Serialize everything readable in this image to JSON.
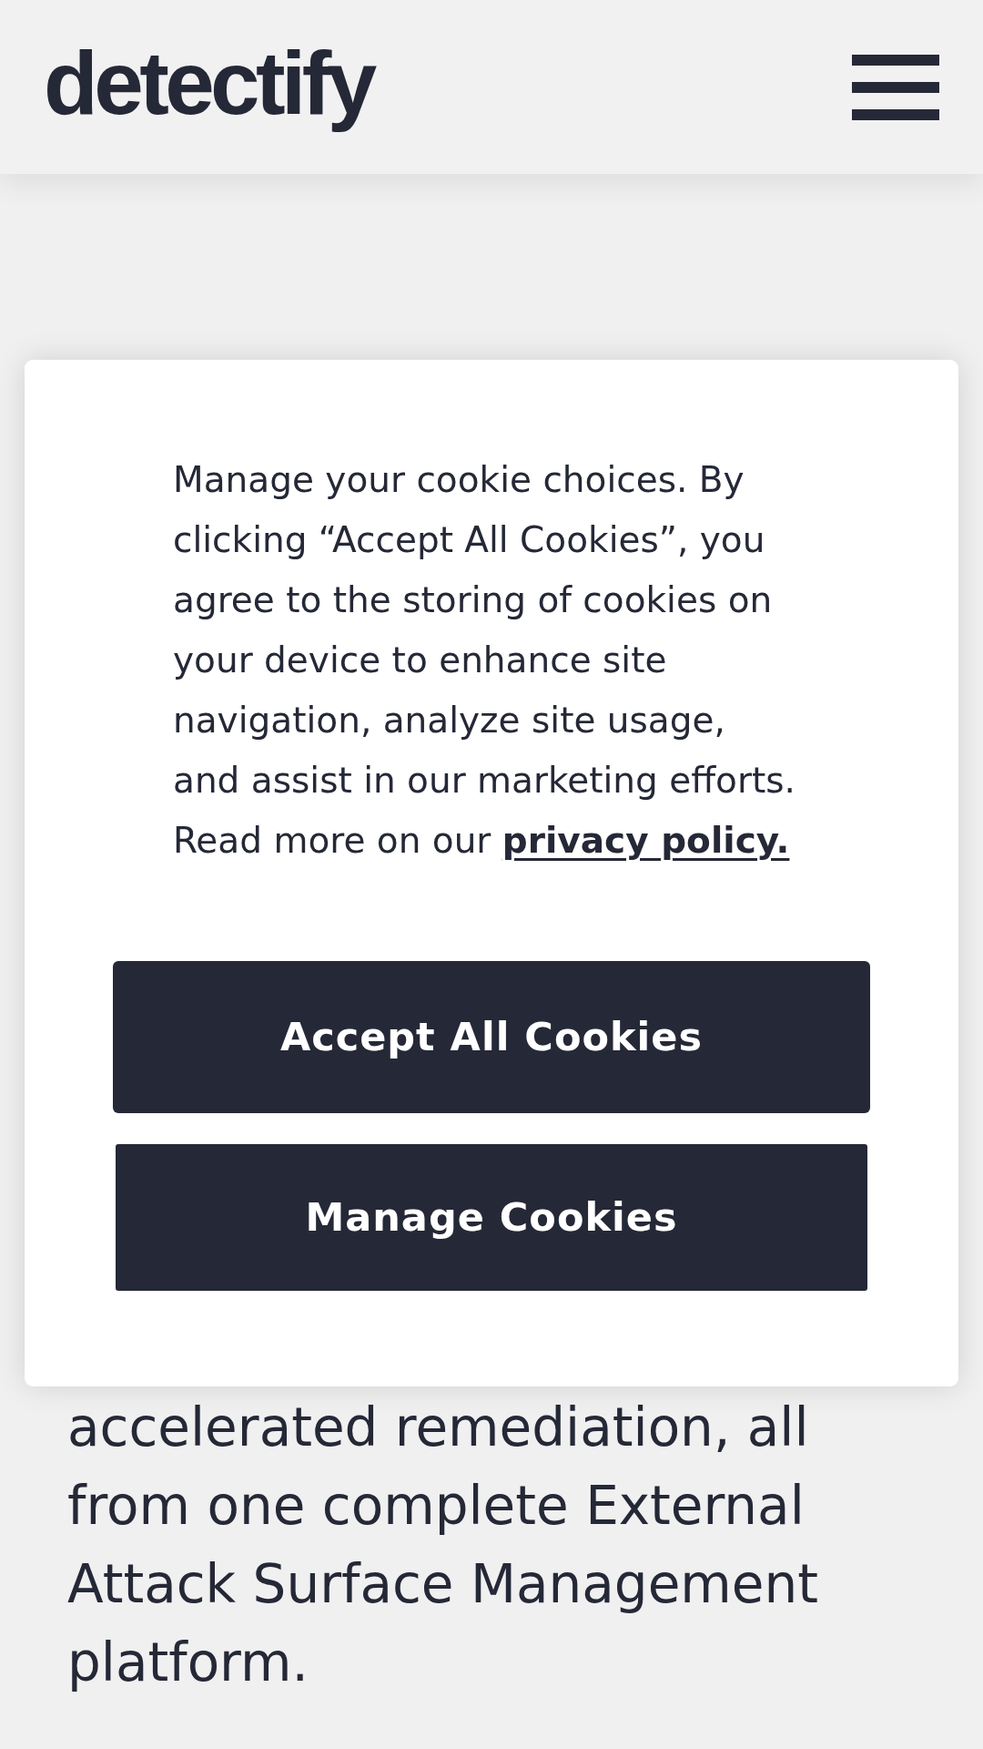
{
  "header": {
    "logo": "detectify"
  },
  "hero": {
    "text": "accelerated remediation, all from one complete External Attack Surface Management platform."
  },
  "cookie_dialog": {
    "message": "Manage your cookie choices. By clicking “Accept All Cookies”, you agree to the storing of cookies on your device to enhance site navigation, analyze site usage, and assist in our marketing efforts. Read more on our",
    "link": "privacy policy.",
    "buttons": [
      "Accept All Cookies",
      "Manage Cookies"
    ]
  }
}
